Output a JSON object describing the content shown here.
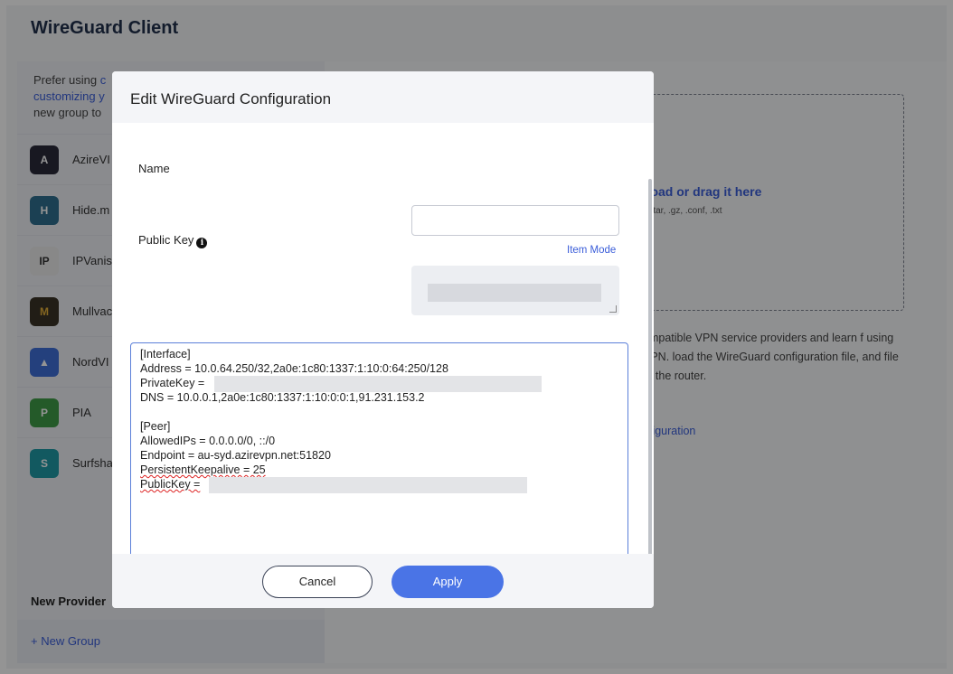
{
  "app": {
    "title": "WireGuard Client"
  },
  "sidebar": {
    "tip_prefix": "Prefer using ",
    "tip_link1": "c",
    "tip_line2": "customizing y",
    "tip_line3": "new group to",
    "providers": [
      {
        "label": "AzireVI",
        "color": "#2a2a3a"
      },
      {
        "label": "Hide.m",
        "color": "#2f6f8f"
      },
      {
        "label": "IPVanis",
        "color": "#eaeaea"
      },
      {
        "label": "Mullvac",
        "color": "#3a3326"
      },
      {
        "label": "NordVI",
        "color": "#3e6ed8"
      },
      {
        "label": "PIA",
        "color": "#3f9b47"
      },
      {
        "label": "Surfsha",
        "color": "#1f9aa5"
      }
    ],
    "new_provider": "New Provider",
    "new_group": "+  New Group"
  },
  "main": {
    "upload_title": "pload or drag it here",
    "upload_hint": ", .tar, .gz, .conf, .txt",
    "desc": "ompatible VPN service providers and learn f using VPN. load the WireGuard configuration file, and file to the router.",
    "link": "nfiguration"
  },
  "modal": {
    "title": "Edit WireGuard Configuration",
    "name_label": "Name",
    "name_value": "",
    "item_mode": "Item Mode",
    "pubkey_label": "Public Key",
    "info_icon": "i",
    "config_lines": {
      "l1": "[Interface]",
      "l2": "Address = 10.0.64.250/32,2a0e:1c80:1337:1:10:0:64:250/128",
      "l3": "PrivateKey =",
      "l4": "DNS = 10.0.0.1,2a0e:1c80:1337:1:10:0:0:1,91.231.153.2",
      "l5": "[Peer]",
      "l6": "AllowedIPs = 0.0.0.0/0, ::/0",
      "l7": "Endpoint = au-syd.azirevpn.net:51820",
      "l8": "PersistentKeepalive = 25",
      "l9": "PublicKey ="
    },
    "cancel": "Cancel",
    "apply": "Apply"
  }
}
